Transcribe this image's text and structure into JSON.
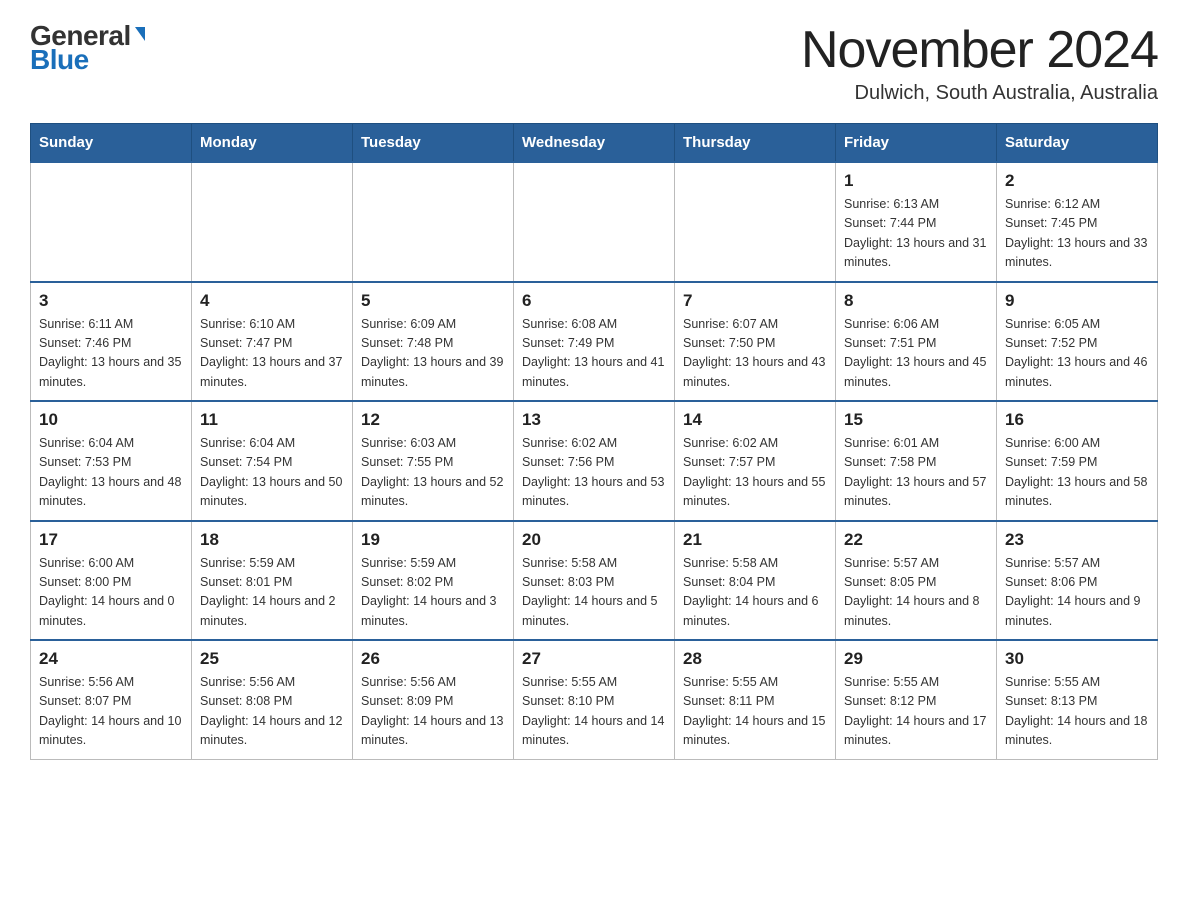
{
  "header": {
    "logo_general": "General",
    "logo_blue": "Blue",
    "month_title": "November 2024",
    "location": "Dulwich, South Australia, Australia"
  },
  "columns": [
    "Sunday",
    "Monday",
    "Tuesday",
    "Wednesday",
    "Thursday",
    "Friday",
    "Saturday"
  ],
  "weeks": [
    [
      {
        "day": "",
        "sunrise": "",
        "sunset": "",
        "daylight": ""
      },
      {
        "day": "",
        "sunrise": "",
        "sunset": "",
        "daylight": ""
      },
      {
        "day": "",
        "sunrise": "",
        "sunset": "",
        "daylight": ""
      },
      {
        "day": "",
        "sunrise": "",
        "sunset": "",
        "daylight": ""
      },
      {
        "day": "",
        "sunrise": "",
        "sunset": "",
        "daylight": ""
      },
      {
        "day": "1",
        "sunrise": "Sunrise: 6:13 AM",
        "sunset": "Sunset: 7:44 PM",
        "daylight": "Daylight: 13 hours and 31 minutes."
      },
      {
        "day": "2",
        "sunrise": "Sunrise: 6:12 AM",
        "sunset": "Sunset: 7:45 PM",
        "daylight": "Daylight: 13 hours and 33 minutes."
      }
    ],
    [
      {
        "day": "3",
        "sunrise": "Sunrise: 6:11 AM",
        "sunset": "Sunset: 7:46 PM",
        "daylight": "Daylight: 13 hours and 35 minutes."
      },
      {
        "day": "4",
        "sunrise": "Sunrise: 6:10 AM",
        "sunset": "Sunset: 7:47 PM",
        "daylight": "Daylight: 13 hours and 37 minutes."
      },
      {
        "day": "5",
        "sunrise": "Sunrise: 6:09 AM",
        "sunset": "Sunset: 7:48 PM",
        "daylight": "Daylight: 13 hours and 39 minutes."
      },
      {
        "day": "6",
        "sunrise": "Sunrise: 6:08 AM",
        "sunset": "Sunset: 7:49 PM",
        "daylight": "Daylight: 13 hours and 41 minutes."
      },
      {
        "day": "7",
        "sunrise": "Sunrise: 6:07 AM",
        "sunset": "Sunset: 7:50 PM",
        "daylight": "Daylight: 13 hours and 43 minutes."
      },
      {
        "day": "8",
        "sunrise": "Sunrise: 6:06 AM",
        "sunset": "Sunset: 7:51 PM",
        "daylight": "Daylight: 13 hours and 45 minutes."
      },
      {
        "day": "9",
        "sunrise": "Sunrise: 6:05 AM",
        "sunset": "Sunset: 7:52 PM",
        "daylight": "Daylight: 13 hours and 46 minutes."
      }
    ],
    [
      {
        "day": "10",
        "sunrise": "Sunrise: 6:04 AM",
        "sunset": "Sunset: 7:53 PM",
        "daylight": "Daylight: 13 hours and 48 minutes."
      },
      {
        "day": "11",
        "sunrise": "Sunrise: 6:04 AM",
        "sunset": "Sunset: 7:54 PM",
        "daylight": "Daylight: 13 hours and 50 minutes."
      },
      {
        "day": "12",
        "sunrise": "Sunrise: 6:03 AM",
        "sunset": "Sunset: 7:55 PM",
        "daylight": "Daylight: 13 hours and 52 minutes."
      },
      {
        "day": "13",
        "sunrise": "Sunrise: 6:02 AM",
        "sunset": "Sunset: 7:56 PM",
        "daylight": "Daylight: 13 hours and 53 minutes."
      },
      {
        "day": "14",
        "sunrise": "Sunrise: 6:02 AM",
        "sunset": "Sunset: 7:57 PM",
        "daylight": "Daylight: 13 hours and 55 minutes."
      },
      {
        "day": "15",
        "sunrise": "Sunrise: 6:01 AM",
        "sunset": "Sunset: 7:58 PM",
        "daylight": "Daylight: 13 hours and 57 minutes."
      },
      {
        "day": "16",
        "sunrise": "Sunrise: 6:00 AM",
        "sunset": "Sunset: 7:59 PM",
        "daylight": "Daylight: 13 hours and 58 minutes."
      }
    ],
    [
      {
        "day": "17",
        "sunrise": "Sunrise: 6:00 AM",
        "sunset": "Sunset: 8:00 PM",
        "daylight": "Daylight: 14 hours and 0 minutes."
      },
      {
        "day": "18",
        "sunrise": "Sunrise: 5:59 AM",
        "sunset": "Sunset: 8:01 PM",
        "daylight": "Daylight: 14 hours and 2 minutes."
      },
      {
        "day": "19",
        "sunrise": "Sunrise: 5:59 AM",
        "sunset": "Sunset: 8:02 PM",
        "daylight": "Daylight: 14 hours and 3 minutes."
      },
      {
        "day": "20",
        "sunrise": "Sunrise: 5:58 AM",
        "sunset": "Sunset: 8:03 PM",
        "daylight": "Daylight: 14 hours and 5 minutes."
      },
      {
        "day": "21",
        "sunrise": "Sunrise: 5:58 AM",
        "sunset": "Sunset: 8:04 PM",
        "daylight": "Daylight: 14 hours and 6 minutes."
      },
      {
        "day": "22",
        "sunrise": "Sunrise: 5:57 AM",
        "sunset": "Sunset: 8:05 PM",
        "daylight": "Daylight: 14 hours and 8 minutes."
      },
      {
        "day": "23",
        "sunrise": "Sunrise: 5:57 AM",
        "sunset": "Sunset: 8:06 PM",
        "daylight": "Daylight: 14 hours and 9 minutes."
      }
    ],
    [
      {
        "day": "24",
        "sunrise": "Sunrise: 5:56 AM",
        "sunset": "Sunset: 8:07 PM",
        "daylight": "Daylight: 14 hours and 10 minutes."
      },
      {
        "day": "25",
        "sunrise": "Sunrise: 5:56 AM",
        "sunset": "Sunset: 8:08 PM",
        "daylight": "Daylight: 14 hours and 12 minutes."
      },
      {
        "day": "26",
        "sunrise": "Sunrise: 5:56 AM",
        "sunset": "Sunset: 8:09 PM",
        "daylight": "Daylight: 14 hours and 13 minutes."
      },
      {
        "day": "27",
        "sunrise": "Sunrise: 5:55 AM",
        "sunset": "Sunset: 8:10 PM",
        "daylight": "Daylight: 14 hours and 14 minutes."
      },
      {
        "day": "28",
        "sunrise": "Sunrise: 5:55 AM",
        "sunset": "Sunset: 8:11 PM",
        "daylight": "Daylight: 14 hours and 15 minutes."
      },
      {
        "day": "29",
        "sunrise": "Sunrise: 5:55 AM",
        "sunset": "Sunset: 8:12 PM",
        "daylight": "Daylight: 14 hours and 17 minutes."
      },
      {
        "day": "30",
        "sunrise": "Sunrise: 5:55 AM",
        "sunset": "Sunset: 8:13 PM",
        "daylight": "Daylight: 14 hours and 18 minutes."
      }
    ]
  ]
}
